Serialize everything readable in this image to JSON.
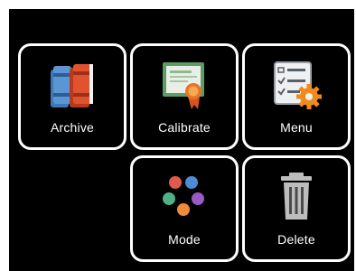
{
  "tiles": [
    {
      "label": "Archive",
      "icon": "books-icon"
    },
    {
      "label": "Calibrate",
      "icon": "certificate-icon"
    },
    {
      "label": "Menu",
      "icon": "checklist-gear-icon"
    },
    {
      "label": "Mode",
      "icon": "colored-dots-icon"
    },
    {
      "label": "Delete",
      "icon": "trash-can-icon"
    }
  ],
  "colors": {
    "background": "#000000",
    "tile_border": "#ffffff",
    "label": "#ffffff",
    "book_blue": "#3f78b8",
    "book_red": "#d94a2e",
    "cert_green": "#5c9d63",
    "seal_orange": "#e8742a",
    "gear_orange": "#f08a1c",
    "dot_red": "#e05a4d",
    "dot_blue": "#4f8ad6",
    "dot_green": "#4fb08a",
    "dot_purple": "#9b59c6",
    "dot_orange": "#ef8a3c",
    "trash_gray": "#bdbdbd"
  }
}
